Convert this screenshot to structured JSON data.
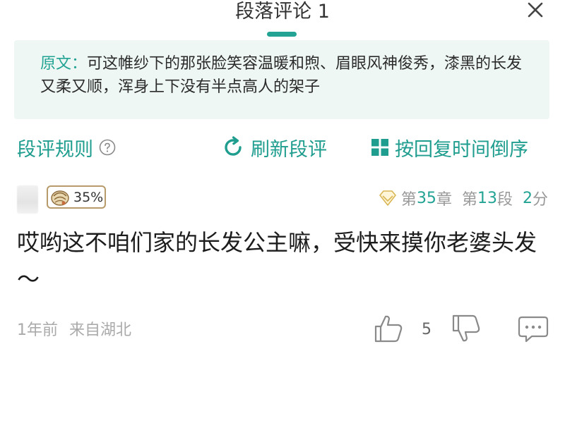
{
  "header": {
    "title": "段落评论 1",
    "close_icon": "close-icon"
  },
  "quote": {
    "label": "原文：",
    "text": "可这帷纱下的那张脸笑容温暖和煦、眉眼风神俊秀，漆黑的长发又柔又顺，浑身上下没有半点高人的架子"
  },
  "toolbar": {
    "rules_label": "段评规则",
    "refresh_label": "刷新段评",
    "sort_label": "按回复时间倒序"
  },
  "comment": {
    "level_badge": "35%",
    "chapter_prefix": "第",
    "chapter_num": "35",
    "chapter_suffix": "章",
    "segment_prefix": "第",
    "segment_num": "13",
    "segment_suffix": "段",
    "score_num": "2",
    "score_suffix": "分",
    "body": "哎哟这不咱们家的长发公主嘛，受快来摸你老婆头发～",
    "time": "1年前",
    "location": "来自湖北",
    "like_count": "5"
  },
  "colors": {
    "accent": "#22a393",
    "quote_bg": "#eef7f4",
    "badge_border": "#b79b6a"
  }
}
